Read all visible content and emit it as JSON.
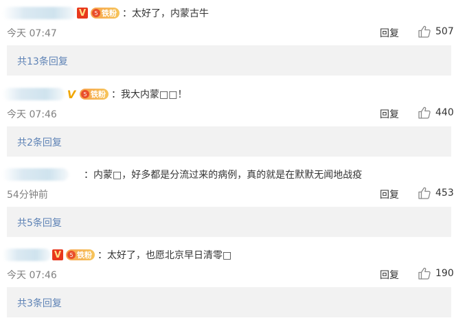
{
  "comments": [
    {
      "vbadge": "V",
      "fan_label": "铁粉",
      "fan_level": "5",
      "text": "：太好了，内蒙古牛",
      "time": "今天 07:47",
      "reply_label": "回复",
      "likes": "507",
      "replies": "共13条回复"
    },
    {
      "vbadge": "V",
      "fan_label": "铁粉",
      "fan_level": "5",
      "text": "：我大内蒙□□！",
      "time": "今天 07:46",
      "reply_label": "回复",
      "likes": "440",
      "replies": "共2条回复"
    },
    {
      "vbadge": "",
      "text": "：内蒙□，好多都是分流过来的病例，真的就是在默默无闻地战疫",
      "time": "54分钟前",
      "reply_label": "回复",
      "likes": "453",
      "replies": "共5条回复"
    },
    {
      "vbadge": "V",
      "fan_label": "铁粉",
      "fan_level": "5",
      "text": "：太好了，也愿北京早日清零□",
      "time": "今天 07:46",
      "reply_label": "回复",
      "likes": "190",
      "replies": "共3条回复"
    }
  ]
}
